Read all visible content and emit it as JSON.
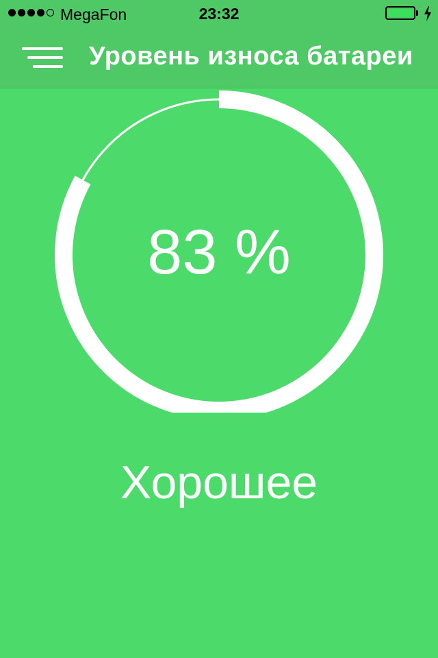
{
  "status_bar": {
    "carrier": "MegaFon",
    "time": "23:32",
    "signal_bars_filled": 4,
    "signal_bars_total": 5,
    "battery_level": 1.0,
    "charging": true
  },
  "nav": {
    "menu_icon": "hamburger-menu-icon",
    "title": "Уровень износа батареи"
  },
  "gauge": {
    "value_percent": 83,
    "value_text": "83 %",
    "status": "Хорошее"
  },
  "colors": {
    "background": "#4cdb6a",
    "bar": "#4ec965",
    "foreground": "#ffffff"
  }
}
